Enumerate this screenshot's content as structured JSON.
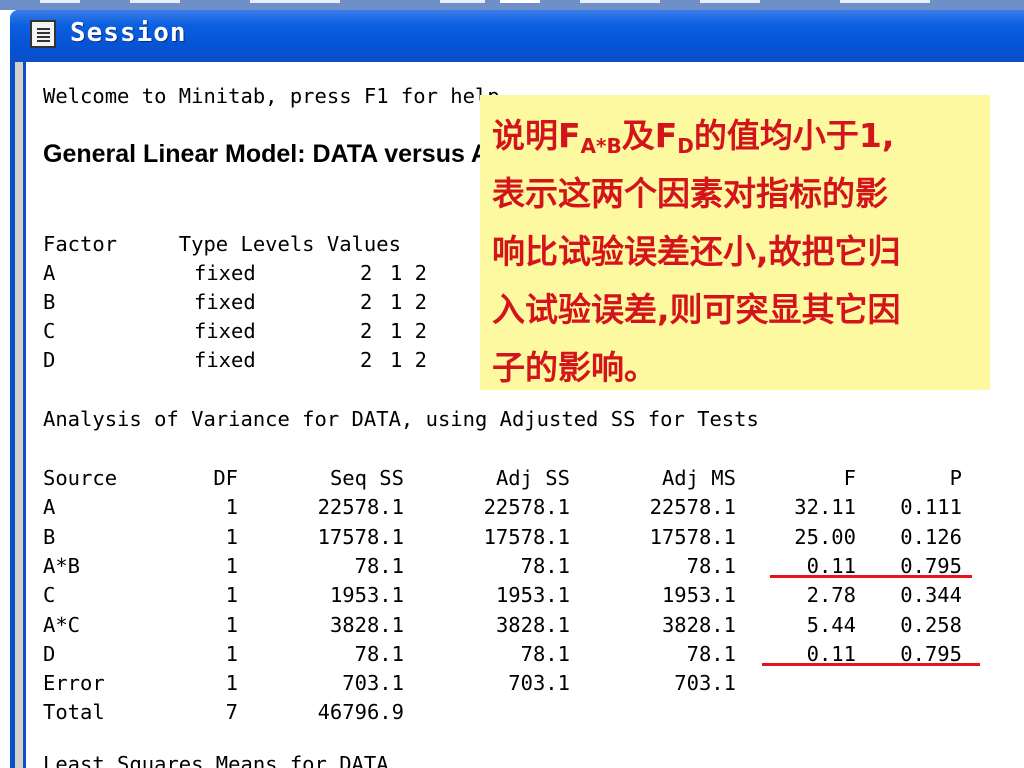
{
  "window": {
    "title": "Session",
    "icon": "session-window-icon"
  },
  "session": {
    "welcome": "Welcome to Minitab, press F1 for help.",
    "heading": "General Linear Model: DATA versus A, B, C, D",
    "factor_header": "Factor     Type Levels Values",
    "factors": [
      {
        "name": "A",
        "type": "fixed",
        "levels": "2",
        "values": "1 2"
      },
      {
        "name": "B",
        "type": "fixed",
        "levels": "2",
        "values": "1 2"
      },
      {
        "name": "C",
        "type": "fixed",
        "levels": "2",
        "values": "1 2"
      },
      {
        "name": "D",
        "type": "fixed",
        "levels": "2",
        "values": "1 2"
      }
    ],
    "anova_title": "Analysis of Variance for DATA, using Adjusted SS for Tests",
    "anova_columns": [
      "Source",
      "DF",
      "Seq SS",
      "Adj SS",
      "Adj MS",
      "F",
      "P"
    ],
    "anova_rows": [
      {
        "source": "A",
        "df": "1",
        "seq_ss": "22578.1",
        "adj_ss": "22578.1",
        "adj_ms": "22578.1",
        "f": "32.11",
        "p": "0.111"
      },
      {
        "source": "B",
        "df": "1",
        "seq_ss": "17578.1",
        "adj_ss": "17578.1",
        "adj_ms": "17578.1",
        "f": "25.00",
        "p": "0.126"
      },
      {
        "source": "A*B",
        "df": "1",
        "seq_ss": "78.1",
        "adj_ss": "78.1",
        "adj_ms": "78.1",
        "f": "0.11",
        "p": "0.795"
      },
      {
        "source": "C",
        "df": "1",
        "seq_ss": "1953.1",
        "adj_ss": "1953.1",
        "adj_ms": "1953.1",
        "f": "2.78",
        "p": "0.344"
      },
      {
        "source": "A*C",
        "df": "1",
        "seq_ss": "3828.1",
        "adj_ss": "3828.1",
        "adj_ms": "3828.1",
        "f": "5.44",
        "p": "0.258"
      },
      {
        "source": "D",
        "df": "1",
        "seq_ss": "78.1",
        "adj_ss": "78.1",
        "adj_ms": "78.1",
        "f": "0.11",
        "p": "0.795"
      },
      {
        "source": "Error",
        "df": "1",
        "seq_ss": "703.1",
        "adj_ss": "703.1",
        "adj_ms": "703.1",
        "f": "",
        "p": ""
      },
      {
        "source": "Total",
        "df": "7",
        "seq_ss": "46796.9",
        "adj_ss": "",
        "adj_ms": "",
        "f": "",
        "p": ""
      }
    ],
    "cutoff_line": "Least Squares Means for DATA"
  },
  "annotation": {
    "prefix": "说明F",
    "sub1": "A*B",
    "mid": "及F",
    "sub2": "D",
    "suffix": "的值均小于1,",
    "line2": "表示这两个因素对指标的影",
    "line3": "响比试验误差还小,故把它归",
    "line4": "入试验误差,则可突显其它因",
    "line5": "子的影响。",
    "color": "#d4141c",
    "background": "#fcf9a0"
  },
  "colors": {
    "titlebar": "#0653d4",
    "underline": "#e8141c"
  }
}
